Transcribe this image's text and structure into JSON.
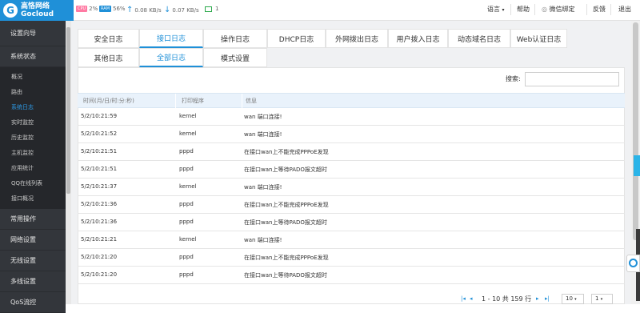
{
  "brand": {
    "name_cn": "高恪网络",
    "name_en": "Gocloud"
  },
  "status": {
    "cpu_chip": "CPU",
    "cpu": "2%",
    "ram_chip": "RAM",
    "ram": "56%",
    "up": "0.08 KB/s",
    "down": "0.07 KB/s",
    "devices": "1"
  },
  "topmenu": {
    "language": "语言",
    "help": "帮助",
    "wechat": "微信绑定",
    "feedback": "反馈",
    "logout": "退出"
  },
  "sidebar": {
    "top": [
      {
        "label": "设置向导"
      },
      {
        "label": "系统状态"
      }
    ],
    "sub": [
      {
        "label": "概况"
      },
      {
        "label": "路由"
      },
      {
        "label": "系统日志"
      },
      {
        "label": "实时监控"
      },
      {
        "label": "历史监控"
      },
      {
        "label": "主机监控"
      },
      {
        "label": "应用统计"
      },
      {
        "label": "QQ在线列表"
      },
      {
        "label": "接口概况"
      }
    ],
    "bottom": [
      {
        "label": "常用操作"
      },
      {
        "label": "网络设置"
      },
      {
        "label": "无线设置"
      },
      {
        "label": "多线设置"
      },
      {
        "label": "QoS流控"
      }
    ]
  },
  "tabs": {
    "row1": [
      {
        "label": "安全日志"
      },
      {
        "label": "接口日志"
      },
      {
        "label": "操作日志"
      },
      {
        "label": "DHCP日志"
      },
      {
        "label": "外网拨出日志"
      },
      {
        "label": "用户拨入日志"
      },
      {
        "label": "动态域名日志"
      },
      {
        "label": "Web认证日志"
      }
    ],
    "row2": [
      {
        "label": "其他日志"
      },
      {
        "label": "全部日志"
      },
      {
        "label": "模式设置"
      }
    ]
  },
  "search": {
    "label": "搜索:",
    "value": "",
    "placeholder": ""
  },
  "table": {
    "headers": [
      "时间(月/日/时:分:秒)",
      "打印程序",
      "信息"
    ],
    "rows": [
      [
        "5/2/10:21:59",
        "kernel",
        "wan 端口连接!"
      ],
      [
        "5/2/10:21:52",
        "kernel",
        "wan 端口连接!"
      ],
      [
        "5/2/10:21:51",
        "pppd",
        "在接口wan上不能完成PPPoE发现"
      ],
      [
        "5/2/10:21:51",
        "pppd",
        "在接口wan上等待PADO报文超时"
      ],
      [
        "5/2/10:21:37",
        "kernel",
        "wan 端口连接!"
      ],
      [
        "5/2/10:21:36",
        "pppd",
        "在接口wan上不能完成PPPoE发现"
      ],
      [
        "5/2/10:21:36",
        "pppd",
        "在接口wan上等待PADO报文超时"
      ],
      [
        "5/2/10:21:21",
        "kernel",
        "wan 端口连接!"
      ],
      [
        "5/2/10:21:20",
        "pppd",
        "在接口wan上不能完成PPPoE发现"
      ],
      [
        "5/2/10:21:20",
        "pppd",
        "在接口wan上等待PADO报文超时"
      ]
    ]
  },
  "pager": {
    "text": "1 - 10 共 159 行",
    "page_size": "10",
    "page": "1"
  },
  "colors": {
    "accent": "#1f90d8",
    "sidebar": "#2f3236",
    "header_row": "#e9f2fb"
  }
}
